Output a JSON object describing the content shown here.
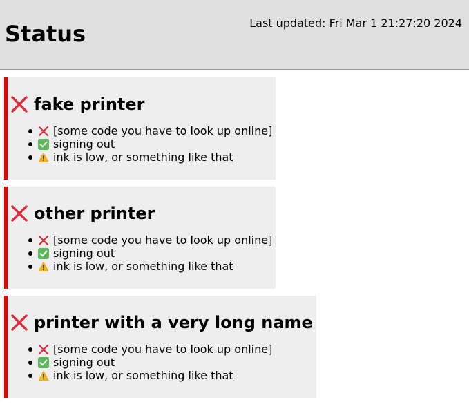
{
  "header": {
    "title": "Status",
    "last_updated": "Last updated: Fri Mar 1 21:27:20 2024"
  },
  "colors": {
    "error": "#dc2d3c",
    "ok": "#5db85b",
    "warning": "#f2b51b",
    "card_border": "#ee0000"
  },
  "printers": [
    {
      "name": "fake printer",
      "status_icon": "cross-mark-icon",
      "items": [
        {
          "icon": "cross-mark-icon",
          "text": "[some code you have to look up online]"
        },
        {
          "icon": "check-mark-icon",
          "text": "signing out"
        },
        {
          "icon": "warning-icon",
          "text": "ink is low, or something like that"
        }
      ]
    },
    {
      "name": "other printer",
      "status_icon": "cross-mark-icon",
      "items": [
        {
          "icon": "cross-mark-icon",
          "text": "[some code you have to look up online]"
        },
        {
          "icon": "check-mark-icon",
          "text": "signing out"
        },
        {
          "icon": "warning-icon",
          "text": "ink is low, or something like that"
        }
      ]
    },
    {
      "name": "printer with a very long name",
      "status_icon": "cross-mark-icon",
      "items": [
        {
          "icon": "cross-mark-icon",
          "text": "[some code you have to look up online]"
        },
        {
          "icon": "check-mark-icon",
          "text": "signing out"
        },
        {
          "icon": "warning-icon",
          "text": "ink is low, or something like that"
        }
      ]
    }
  ]
}
